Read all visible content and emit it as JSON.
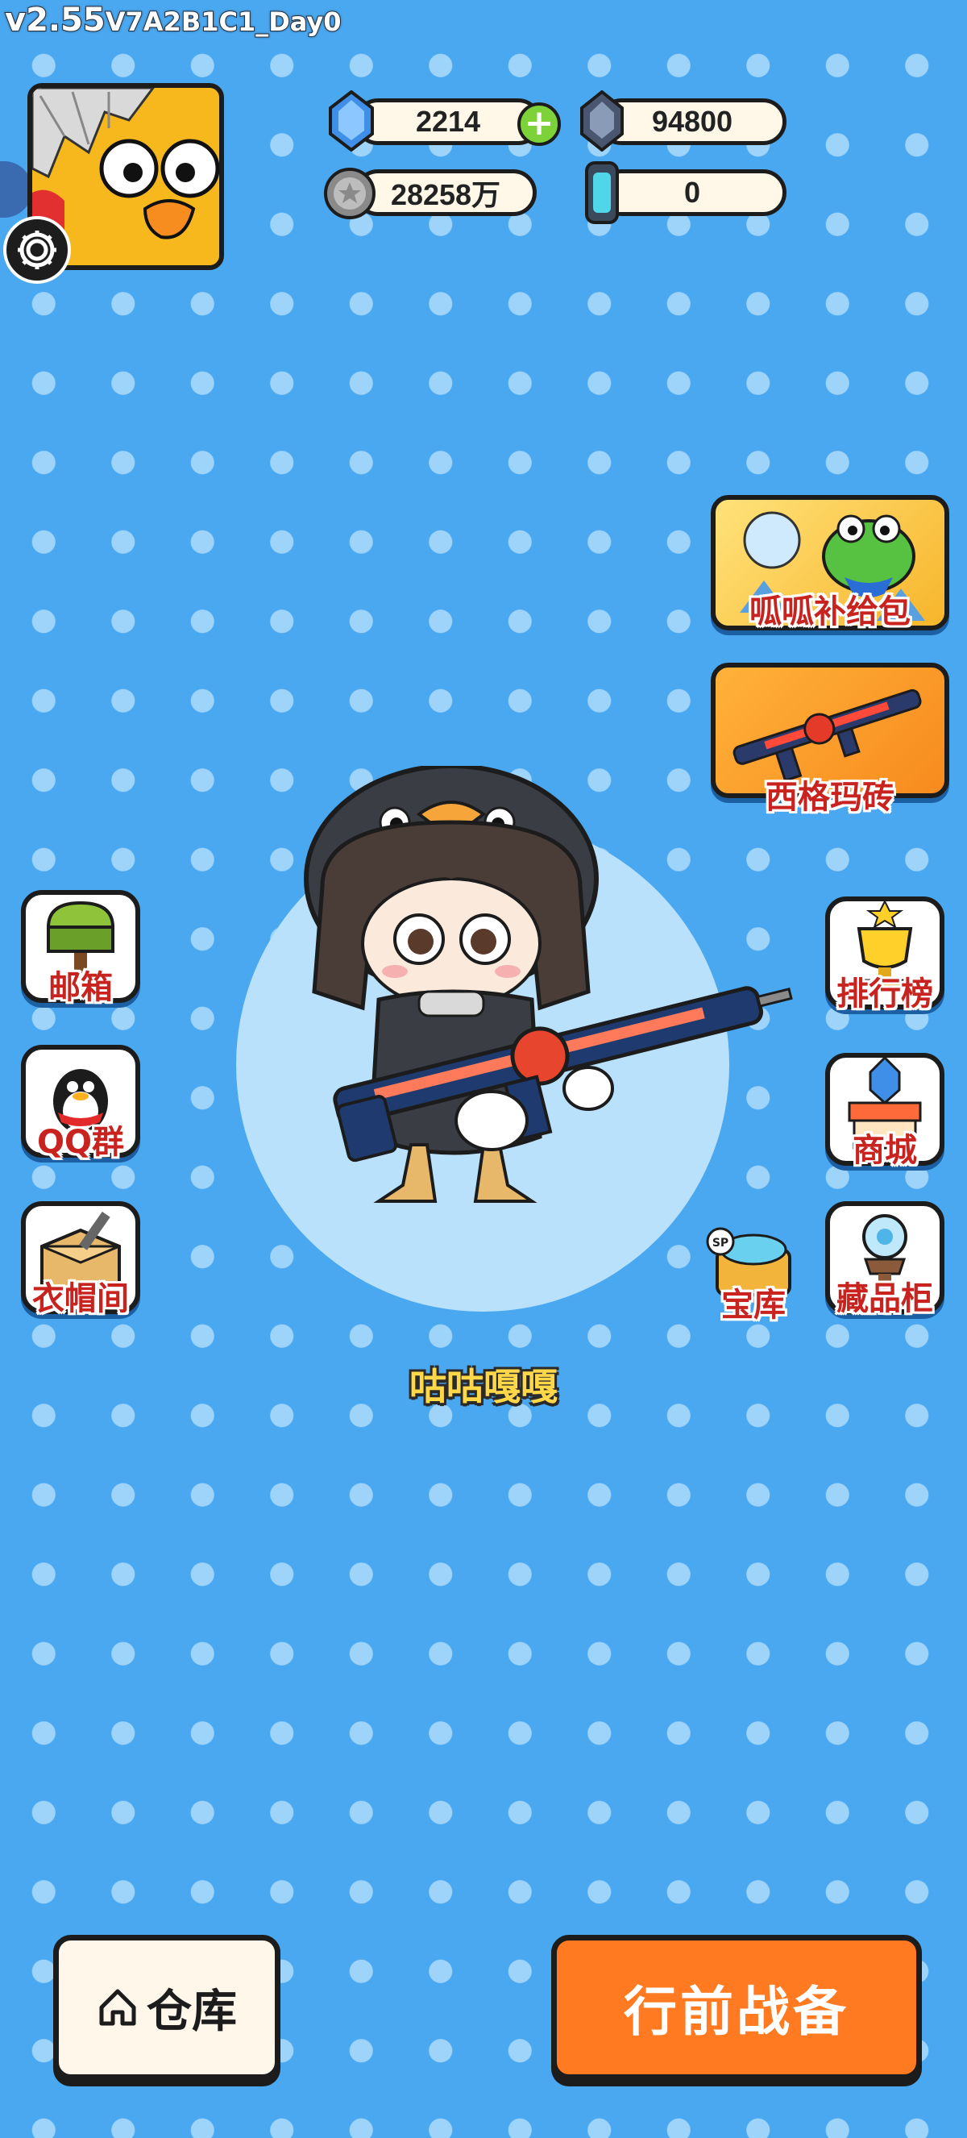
{
  "version": {
    "main": "v2.55",
    "build": "V7A2B1C1_Day0"
  },
  "currencies": {
    "diamond": "2214",
    "crystal": "94800",
    "coin": "28258万",
    "ticket": "0"
  },
  "right_banners": [
    {
      "label": "呱呱补给包"
    },
    {
      "label": "西格玛砖"
    }
  ],
  "left_menu": [
    {
      "label": "邮箱"
    },
    {
      "label": "QQ群"
    },
    {
      "label": "衣帽间"
    }
  ],
  "right_menu": [
    {
      "label": "排行榜"
    },
    {
      "label": "商城"
    },
    {
      "label": "宝库"
    },
    {
      "label": "藏品柜"
    }
  ],
  "character": {
    "name": "咕咕嘎嘎"
  },
  "bottom": {
    "warehouse_label": "仓库",
    "battle_label": "行前战备"
  },
  "colors": {
    "background": "#4aa8f0",
    "label_red": "#c8231f",
    "battle_orange": "#ff7a21",
    "name_yellow": "#ffd84a"
  }
}
